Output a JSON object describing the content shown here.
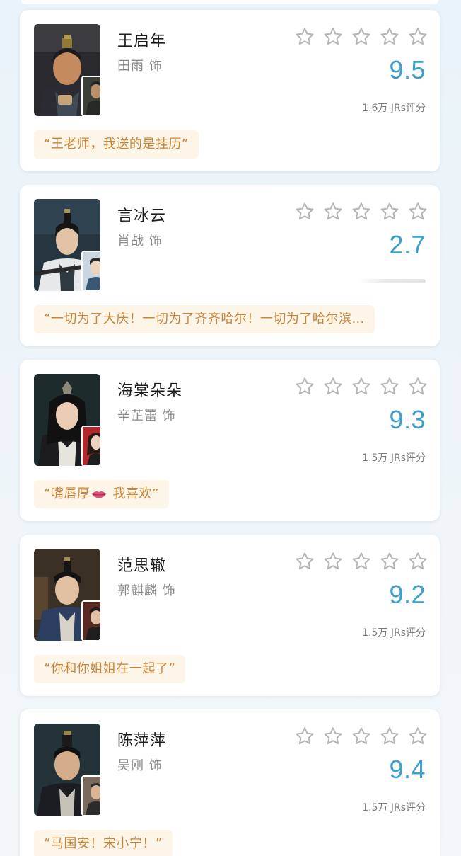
{
  "characters": [
    {
      "name": "王启年",
      "actor": "田雨 饰",
      "score": "9.5",
      "ratings_count": "1.6万 JRs评分",
      "quote": "“王老师，我送的是挂历”",
      "colors": {
        "poster_bg": "#2a2a2e",
        "inset_bg": "#3a3f38"
      }
    },
    {
      "name": "言冰云",
      "actor": "肖战 饰",
      "score": "2.7",
      "ratings_count": "",
      "quote": "“一切为了大庆！一切为了齐齐哈尔！一切为了哈尔滨…",
      "colors": {
        "poster_bg": "#263640",
        "inset_bg": "#c9d6e0"
      }
    },
    {
      "name": "海棠朵朵",
      "actor": "辛芷蕾 饰",
      "score": "9.3",
      "ratings_count": "1.5万 JRs评分",
      "quote_before": "“嘴唇厚",
      "quote_after": " 我喜欢”",
      "quote_emoji": "lips-emoji",
      "colors": {
        "poster_bg": "#1d2b2c",
        "inset_bg": "#b3262b"
      }
    },
    {
      "name": "范思辙",
      "actor": "郭麒麟 饰",
      "score": "9.2",
      "ratings_count": "1.5万 JRs评分",
      "quote": "“你和你姐姐在一起了”",
      "colors": {
        "poster_bg": "#3a3024",
        "inset_bg": "#5a2a22"
      }
    },
    {
      "name": "陈萍萍",
      "actor": "吴刚 饰",
      "score": "9.4",
      "ratings_count": "1.5万 JRs评分",
      "quote": "“马国安！宋小宁！”",
      "colors": {
        "poster_bg": "#233338",
        "inset_bg": "#7a6a5e"
      }
    }
  ],
  "theme": {
    "score_color": "#3d9fcb",
    "star_outline": "#b5b5b5",
    "quote_bg": "#fdf6e8",
    "quote_text": "#c7843a"
  }
}
